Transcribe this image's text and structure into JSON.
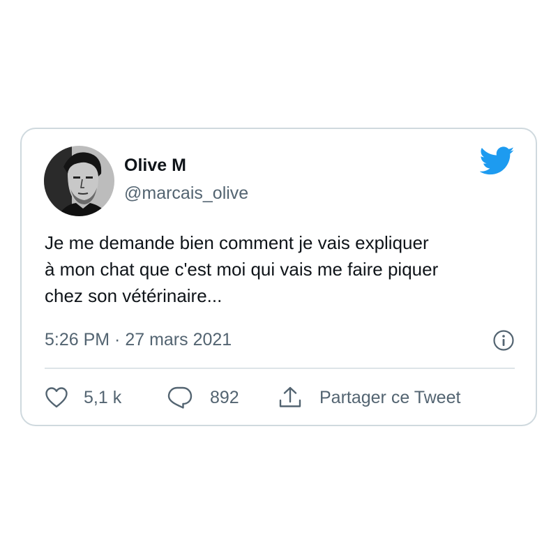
{
  "tweet": {
    "author_name": "Olive M",
    "author_handle": "@marcais_olive",
    "text": "Je me demande bien comment je vais expliquer\nà mon chat que c'est moi qui vais me faire piquer\nchez son vétérinaire...",
    "timestamp": "5:26 PM · 27 mars 2021"
  },
  "actions": {
    "likes": "5,1 k",
    "replies": "892",
    "share_label": "Partager ce Tweet"
  },
  "icons": {
    "brand": "twitter-bird-icon",
    "info": "info-icon",
    "like": "heart-icon",
    "reply": "speech-bubble-icon",
    "share": "share-icon"
  },
  "colors": {
    "brand": "#1d9bf0",
    "text": "#0f1419",
    "secondary": "#536471",
    "border": "#cfd9de"
  }
}
